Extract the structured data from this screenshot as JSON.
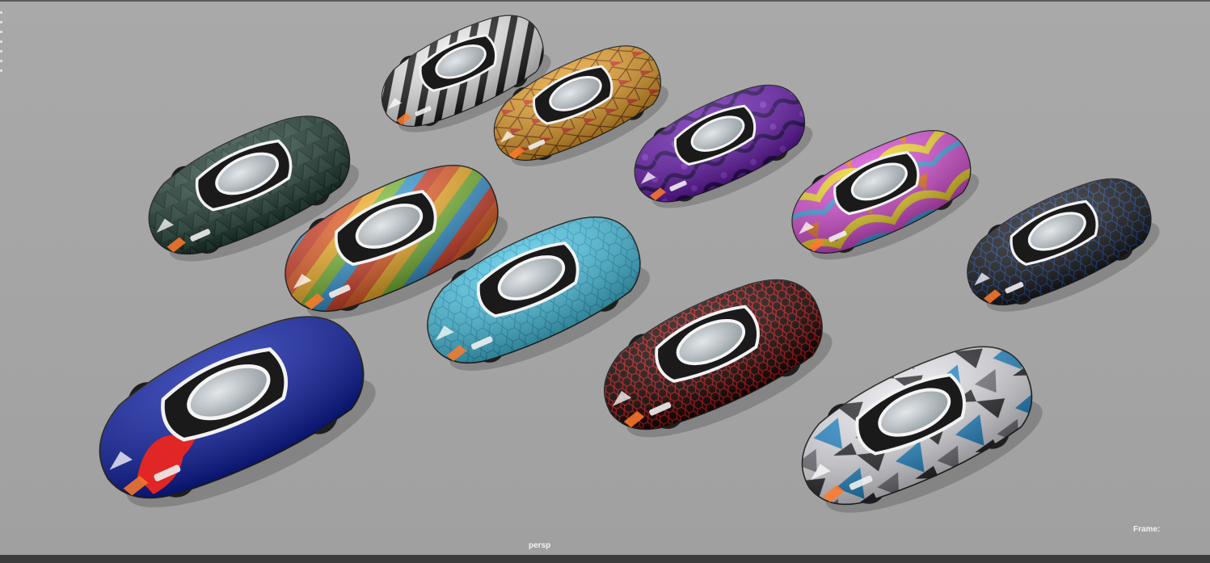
{
  "viewport": {
    "camera_name": "persp",
    "frame_label": "Frame:"
  },
  "cars": [
    {
      "name": "zebra",
      "body": "#e6e6e6",
      "accent": "#1b1b1b",
      "pattern": "zebra"
    },
    {
      "name": "yellow-red-mosaic",
      "body": "#e59a28",
      "accent": "#d8332a",
      "pattern": "mosaic"
    },
    {
      "name": "purple-marble",
      "body": "#6e1fb4",
      "accent": "#3a0e73",
      "pattern": "marble"
    },
    {
      "name": "dark-green-triangles",
      "body": "#1f3a32",
      "accent": "#0f201b",
      "pattern": "tri"
    },
    {
      "name": "rainbow-stripes",
      "body": "#f0b02c",
      "accent": "#4e9ad8",
      "pattern": "stripes"
    },
    {
      "name": "cyan-hexagons",
      "body": "#49c6e4",
      "accent": "#2a9fd0",
      "pattern": "hex"
    },
    {
      "name": "multicolor-swirl",
      "body": "#d24bd1",
      "accent": "#f2d52b",
      "pattern": "swirl"
    },
    {
      "name": "black-blue-hex",
      "body": "#1c1c1e",
      "accent": "#1f4fa8",
      "pattern": "hex-dark"
    },
    {
      "name": "blue-dragon",
      "body": "#0d1ea5",
      "accent": "#e12626",
      "pattern": "dragon"
    },
    {
      "name": "red-black-mesh",
      "body": "#c51515",
      "accent": "#1a0606",
      "pattern": "mesh"
    },
    {
      "name": "arctic-camo",
      "body": "#e9e9ee",
      "accent": "#2a8fd0",
      "pattern": "camo"
    }
  ]
}
